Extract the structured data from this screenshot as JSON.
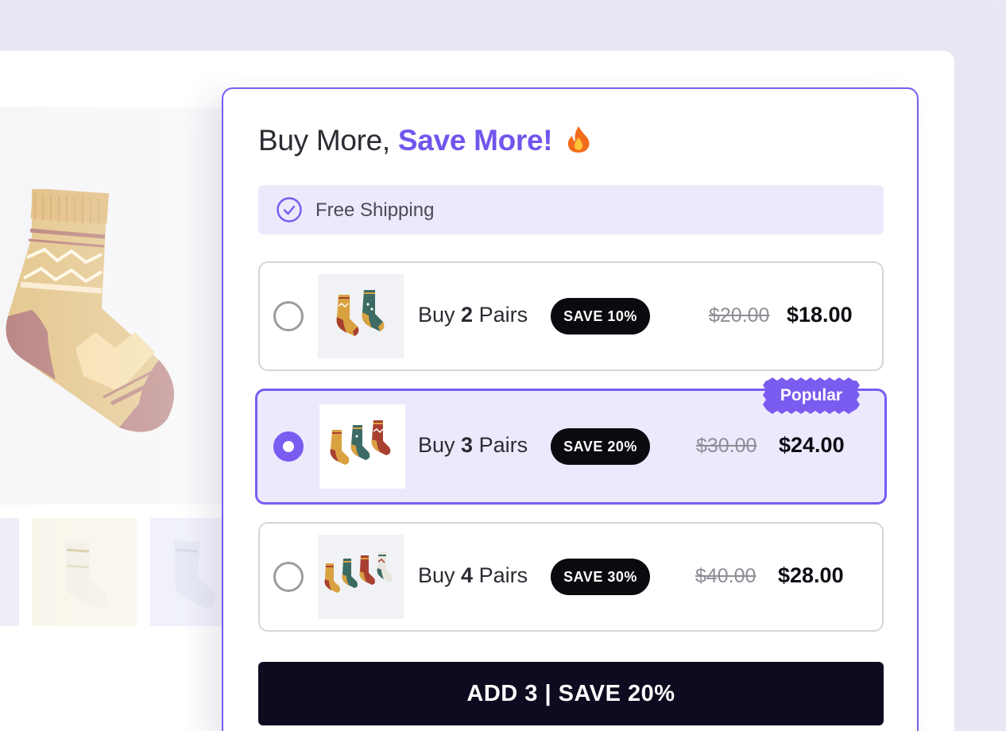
{
  "widget": {
    "title_prefix": "Buy More, ",
    "title_accent": "Save More!",
    "title_emoji": "fire-icon",
    "shipping_label": "Free Shipping",
    "accent_color": "#7a5cf0",
    "options": [
      {
        "prefix": "Buy ",
        "qty": "2",
        "suffix": " Pairs",
        "badge": "SAVE 10%",
        "old_price": "$20.00",
        "new_price": "$18.00",
        "selected": false
      },
      {
        "prefix": "Buy ",
        "qty": "3",
        "suffix": " Pairs",
        "badge": "SAVE 20%",
        "old_price": "$30.00",
        "new_price": "$24.00",
        "selected": true,
        "tag": "Popular"
      },
      {
        "prefix": "Buy ",
        "qty": "4",
        "suffix": " Pairs",
        "badge": "SAVE 30%",
        "old_price": "$40.00",
        "new_price": "$28.00",
        "selected": false
      }
    ],
    "cta_label": "ADD 3 | SAVE 20%"
  }
}
